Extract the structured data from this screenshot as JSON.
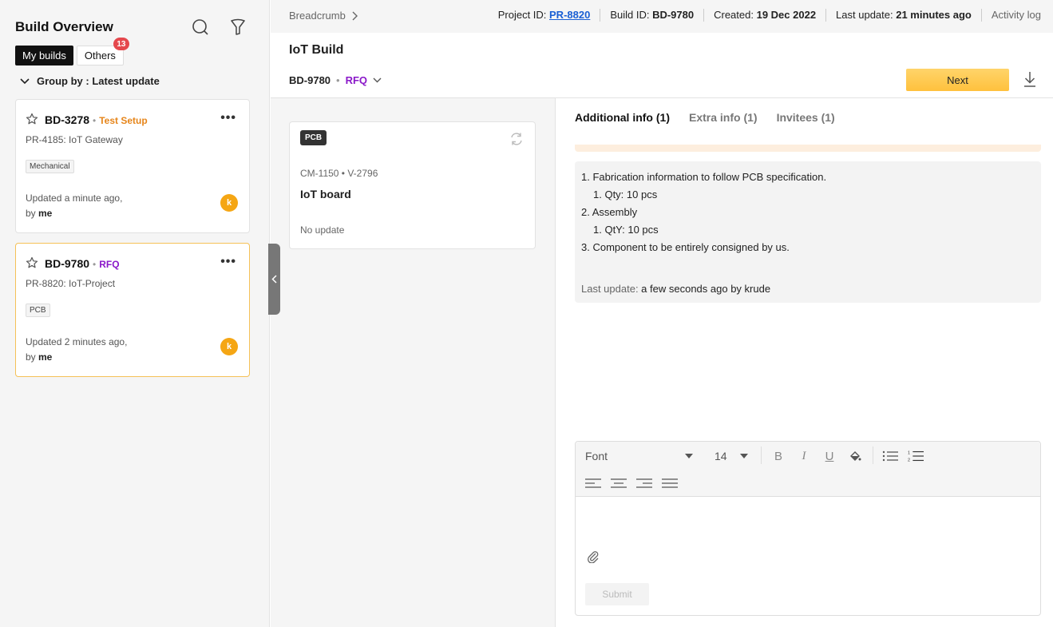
{
  "sidebar": {
    "title": "Build Overview",
    "tabs": [
      {
        "label": "My builds",
        "active": true
      },
      {
        "label": "Others",
        "badge": "13"
      }
    ],
    "group_by": "Group by : Latest update",
    "cards": [
      {
        "id": "BD-3278",
        "sep": "•",
        "status": "Test Setup",
        "status_color": "#e6851a",
        "project": "PR-4185: IoT Gateway",
        "tag": "Mechanical",
        "updated": "Updated a minute ago,",
        "by_prefix": "by ",
        "by": "me",
        "avatar": "k"
      },
      {
        "id": "BD-9780",
        "sep": "•",
        "status": "RFQ",
        "status_color": "#8a18c9",
        "project": "PR-8820: IoT-Project",
        "tag": "PCB",
        "updated": "Updated 2 minutes ago,",
        "by_prefix": "by ",
        "by": "me",
        "avatar": "k"
      }
    ]
  },
  "topbar": {
    "breadcrumb": "Breadcrumb",
    "project_label": "Project ID: ",
    "project_id": "PR-8820",
    "build_label": "Build ID: ",
    "build_id": "BD-9780",
    "created_label": "Created: ",
    "created": "19 Dec 2022",
    "last_label": "Last update: ",
    "last": "21 minutes ago",
    "activity": "Activity log"
  },
  "header": {
    "title": "IoT Build",
    "build_id": "BD-9780",
    "sep": "•",
    "status": "RFQ",
    "next_label": "Next"
  },
  "part": {
    "badge": "PCB",
    "ids": "CM-1150 • V-2796",
    "name": "IoT board",
    "update": "No update"
  },
  "tabs": [
    {
      "label": "Additional info (1)",
      "active": true
    },
    {
      "label": "Extra info (1)"
    },
    {
      "label": "Invitees (1)"
    }
  ],
  "info": {
    "lines": [
      {
        "text": "1. Fabrication information to follow PCB specification.",
        "sub": false
      },
      {
        "text": "1. Qty: 10 pcs",
        "sub": true
      },
      {
        "text": "2. Assembly",
        "sub": false
      },
      {
        "text": "1. QtY: 10 pcs",
        "sub": true
      },
      {
        "text": "3. Component to be entirely consigned by us.",
        "sub": false
      }
    ],
    "last_label": "Last update: ",
    "last_value": "a few seconds ago by krude"
  },
  "editor": {
    "font": "Font",
    "size": "14",
    "bold": "B",
    "italic": "I",
    "underline": "U",
    "submit": "Submit"
  },
  "colors": {
    "accent": "#ffc13d",
    "badge": "#e5484d",
    "rfq": "#8a18c9",
    "test_setup": "#e6851a",
    "link": "#1a5fd4"
  }
}
